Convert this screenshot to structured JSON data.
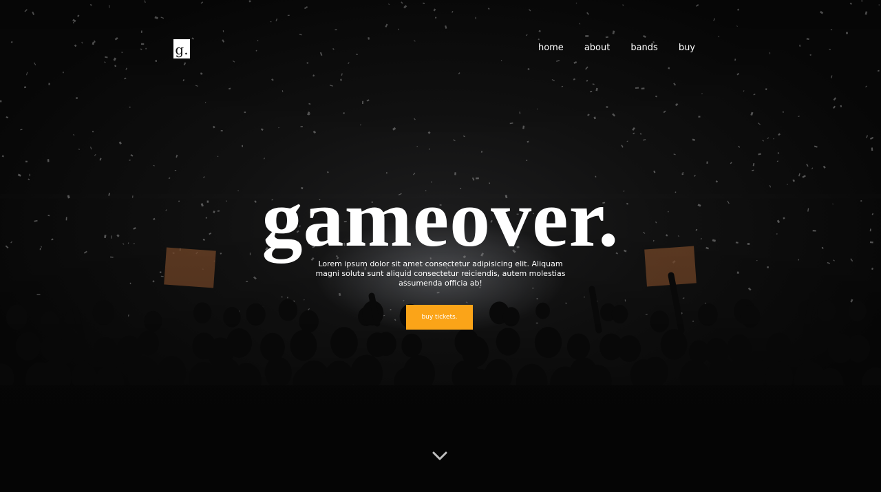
{
  "header": {
    "logo_text": "g.",
    "nav": [
      {
        "label": "home"
      },
      {
        "label": "about"
      },
      {
        "label": "bands"
      },
      {
        "label": "buy"
      }
    ]
  },
  "hero": {
    "title": "gameover.",
    "description": "Lorem ipsum dolor sit amet consectetur adipisicing elit. Aliquam magni soluta sunt aliquid consectetur reiciendis, autem molestias assumenda officia ab!",
    "cta_label": "buy tickets.",
    "scroll_icon": "chevron-down-icon"
  },
  "colors": {
    "accent": "#fba418",
    "text": "#ffffff",
    "background": "#0b0b0b"
  }
}
